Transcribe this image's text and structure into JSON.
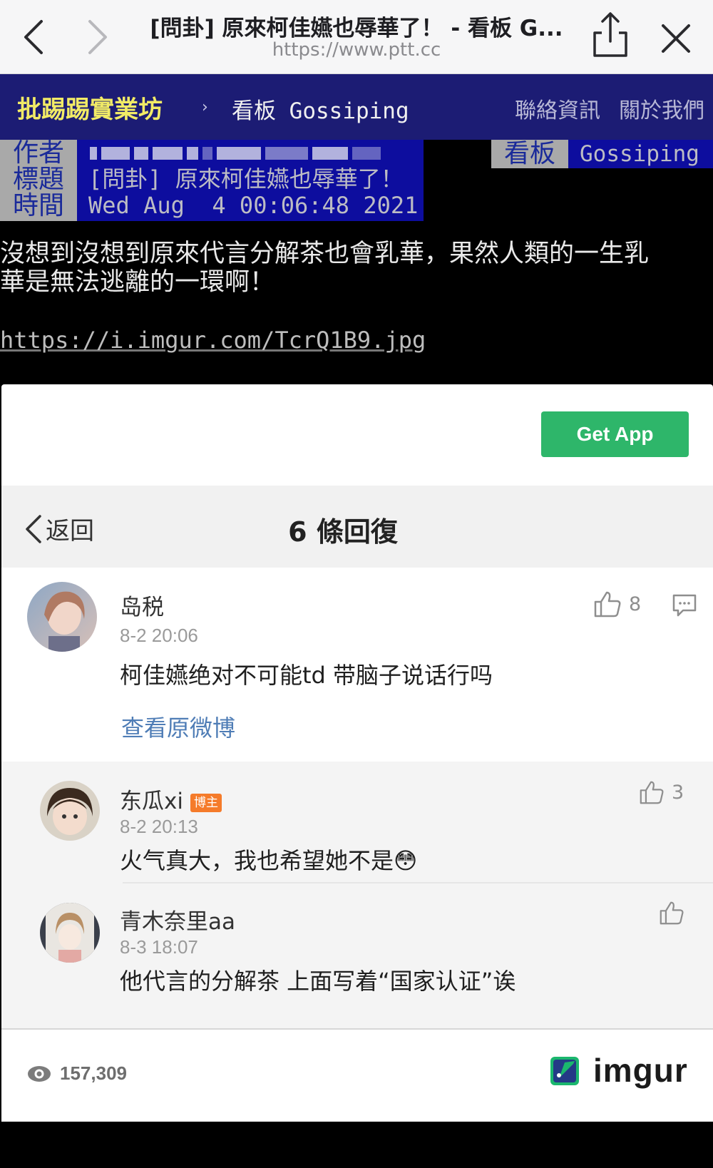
{
  "browser": {
    "page_title": "[問卦] 原來柯佳嬿也辱華了！ - 看板 G...",
    "url": "https://www.ptt.cc",
    "icons": {
      "back": "chevron-left-icon",
      "forward": "chevron-right-icon",
      "share": "share-icon",
      "close": "close-icon"
    }
  },
  "ptt": {
    "brand": "批踢踢實業坊",
    "separator": "›",
    "board_crumb": "看板 Gossiping",
    "links": [
      "聯絡資訊",
      "關於我們"
    ],
    "colors": {
      "header_bg": "#1c1c74",
      "brand": "#f2eb66",
      "meta_bg": "#0d0d9e",
      "tag_bg": "#a9a9a9"
    }
  },
  "article": {
    "tags": {
      "author": "作者",
      "title": "標題",
      "time": "時間",
      "board": "看板"
    },
    "title": "[問卦] 原來柯佳嬿也辱華了！",
    "time": "Wed Aug  4 00:06:48 2021",
    "board": "Gossiping",
    "body_line1": "沒想到沒想到原來代言分解茶也會乳華，果然人類的一生乳",
    "body_line2": "華是無法逃離的一環啊！",
    "image_link": "https://i.imgur.com/TcrQ1B9.jpg"
  },
  "embed": {
    "get_app": "Get App",
    "back_label": "返回",
    "reply_count_title": "6 條回復",
    "main_comment": {
      "user": "岛税",
      "time": "8-2 20:06",
      "text": "柯佳嬿绝对不可能td 带脑子说话行吗",
      "likes": "8",
      "view_original": "查看原微博"
    },
    "replies": [
      {
        "user": "东瓜xi",
        "badge": "博主",
        "time": "8-2 20:13",
        "text": "火气真大，我也希望她不是😳",
        "likes": "3"
      },
      {
        "user": "青木奈里aa",
        "time": "8-3 18:07",
        "text": "他代言的分解茶 上面写着“国家认证”诶",
        "likes": ""
      }
    ],
    "views": "157,309",
    "brand": "imgur",
    "colors": {
      "get_app": "#2eb66a",
      "link": "#4f7db6",
      "badge": "#f57b2a"
    }
  }
}
